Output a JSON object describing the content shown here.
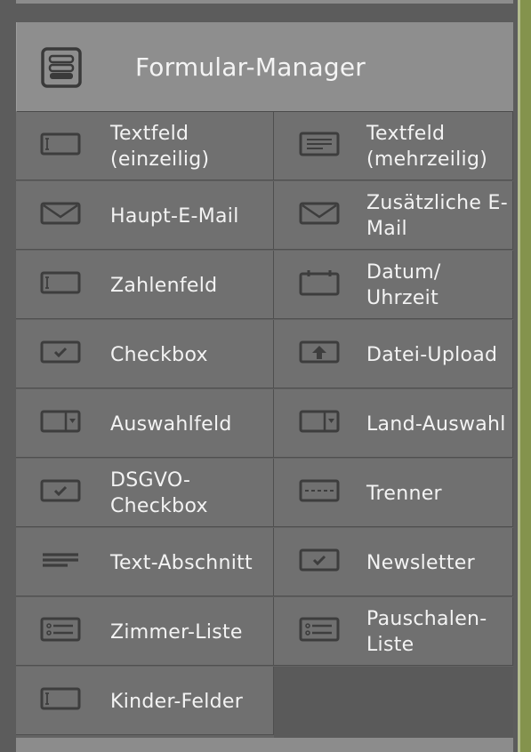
{
  "header": {
    "title": "Formular-Manager",
    "icon": "form-icon"
  },
  "fields": [
    {
      "label": "Textfeld (einzeilig)",
      "icon": "text-field-icon"
    },
    {
      "label": "Textfeld (mehrzeilig)",
      "icon": "textarea-icon"
    },
    {
      "label": "Haupt-E-Mail",
      "icon": "envelope-icon"
    },
    {
      "label": "Zusätzliche E-Mail",
      "icon": "envelope-icon"
    },
    {
      "label": "Zahlenfeld",
      "icon": "text-field-icon"
    },
    {
      "label": "Datum/ Uhrzeit",
      "icon": "calendar-icon"
    },
    {
      "label": "Checkbox",
      "icon": "checkbox-icon"
    },
    {
      "label": "Datei-Upload",
      "icon": "upload-icon"
    },
    {
      "label": "Auswahlfeld",
      "icon": "select-icon"
    },
    {
      "label": "Land-Auswahl",
      "icon": "select-icon"
    },
    {
      "label": "DSGVO-Checkbox",
      "icon": "checkbox-icon"
    },
    {
      "label": "Trenner",
      "icon": "separator-icon"
    },
    {
      "label": "Text-Abschnitt",
      "icon": "paragraph-icon"
    },
    {
      "label": "Newsletter",
      "icon": "checkbox-icon"
    },
    {
      "label": "Zimmer-Liste",
      "icon": "list-icon"
    },
    {
      "label": "Pauschalen-Liste",
      "icon": "list-icon"
    },
    {
      "label": "Kinder-Felder",
      "icon": "text-field-icon"
    }
  ]
}
